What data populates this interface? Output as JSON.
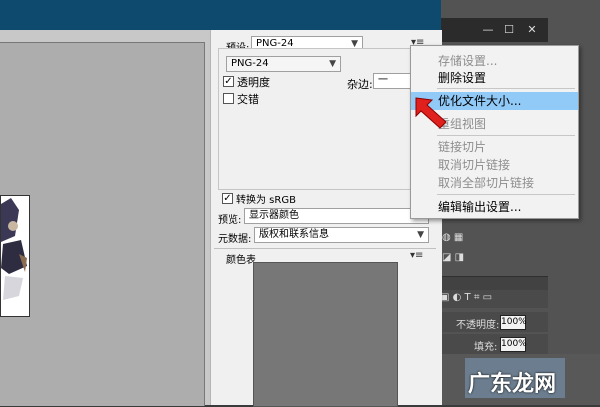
{
  "dialog": {
    "preset_label": "预设:",
    "preset_value": "PNG-24",
    "format_value": "PNG-24",
    "transparency_label": "透明度",
    "transparency_checked": true,
    "matte_label": "杂边:",
    "matte_value": "一",
    "interlaced_label": "交错",
    "interlaced_checked": false,
    "convert_srgb_label": "转换为 sRGB",
    "convert_srgb_checked": true,
    "preview_label": "预览:",
    "preview_value": "显示器颜色",
    "metadata_label": "元数据:",
    "metadata_value": "版权和联系信息",
    "color_table_label": "颜色表"
  },
  "menu": {
    "items": [
      {
        "label": "存储设置...",
        "enabled": false
      },
      {
        "label": "删除设置",
        "enabled": true
      },
      {
        "label": "优化文件大小...",
        "enabled": true,
        "highlighted": true
      },
      {
        "label": "重组视图",
        "enabled": false
      },
      {
        "label": "链接切片",
        "enabled": false
      },
      {
        "label": "取消切片链接",
        "enabled": false
      },
      {
        "label": "取消全部切片链接",
        "enabled": false
      },
      {
        "label": "编辑输出设置...",
        "enabled": true
      }
    ]
  },
  "ps_panel": {
    "opacity_label": "不透明度:",
    "opacity_value": "100%",
    "fill_label": "填充:",
    "fill_value": "100%"
  },
  "watermark": "广东龙网",
  "colors": {
    "dialog_titlebar": "#0e4a6e",
    "menu_highlight": "#91c9f7",
    "annotation_arrow": "#e0201c"
  }
}
